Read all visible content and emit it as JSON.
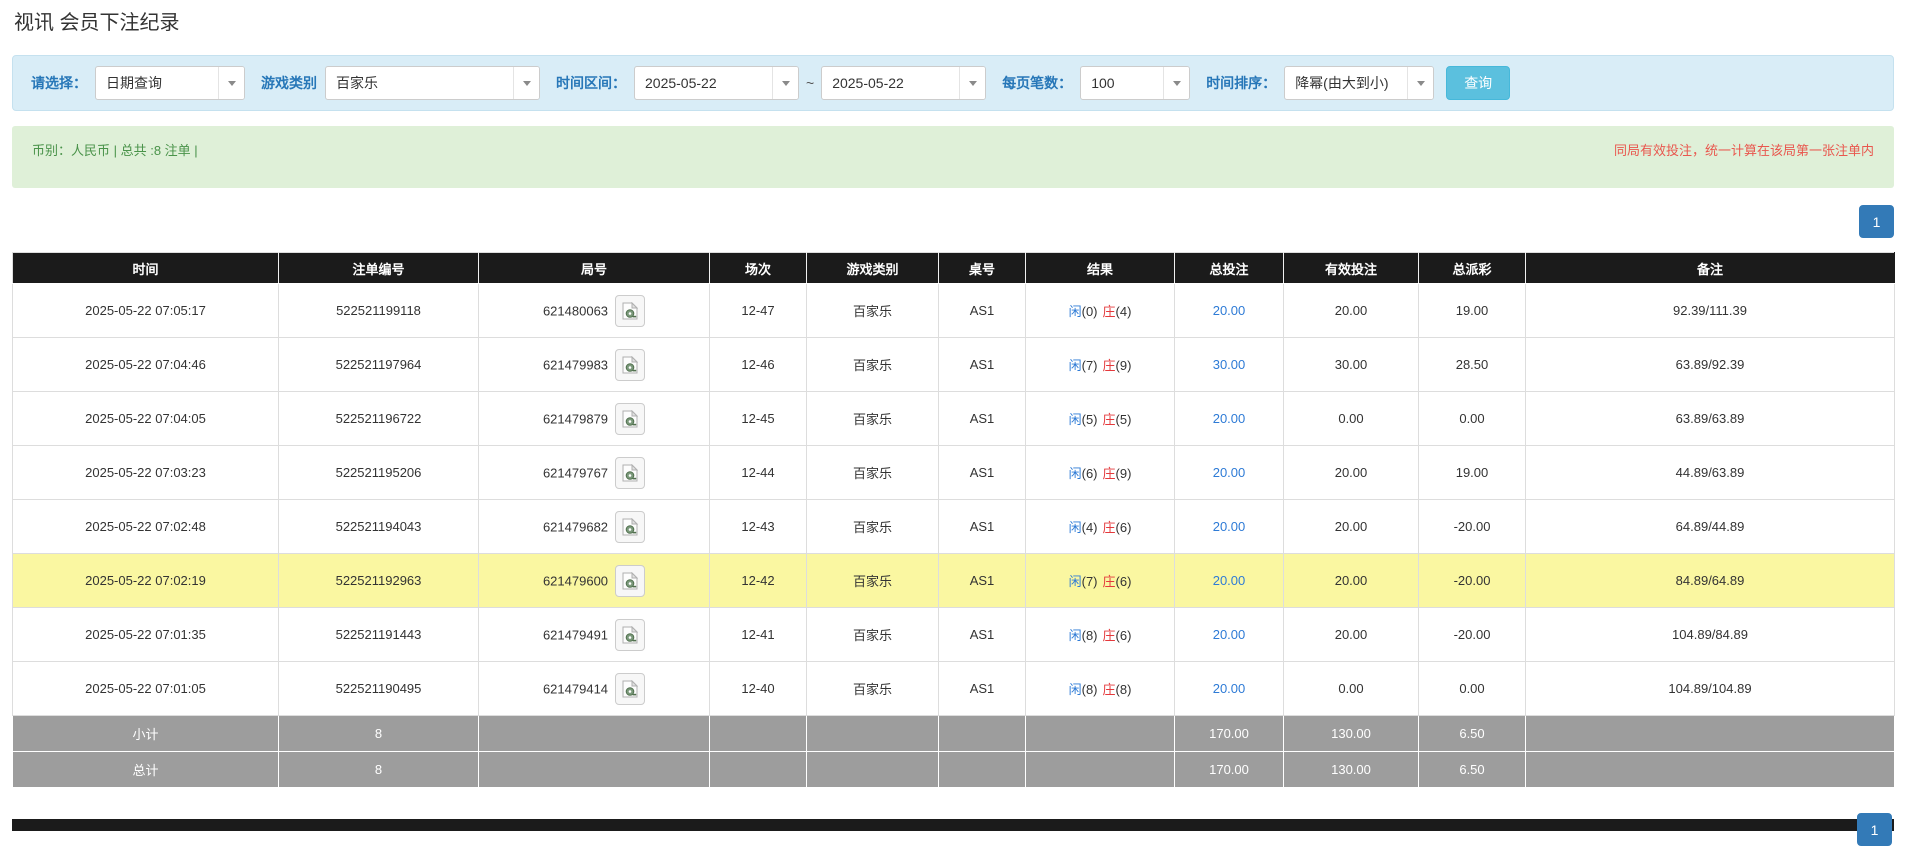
{
  "page_title": "视讯 会员下注纪录",
  "filter_bar": {
    "query_type_label": "请选择：",
    "query_type_value": "日期查询",
    "game_type_label": "游戏类别",
    "game_type_value": "百家乐",
    "time_range_label": "时间区间：",
    "date_from": "2025-05-22",
    "date_separator": "~",
    "date_to": "2025-05-22",
    "page_size_label": "每页笔数：",
    "page_size_value": "100",
    "time_sort_label": "时间排序：",
    "time_sort_value": "降幂(由大到小)",
    "search_button_label": "查询"
  },
  "summary_bar": {
    "currency_summary": "币别：人民币 | 总共 :8 注单 |",
    "note": "同局有效投注，统一计算在该局第一张注单内"
  },
  "pagination": {
    "current_page": "1"
  },
  "table": {
    "headers": [
      "时间",
      "注单编号",
      "局号",
      "场次",
      "游戏类别",
      "桌号",
      "结果",
      "总投注",
      "有效投注",
      "总派彩",
      "备注"
    ],
    "rows": [
      {
        "time": "2025-05-22 07:05:17",
        "bet_no": "522521199118",
        "round_no": "621480063",
        "session": "12-47",
        "game_type": "百家乐",
        "table_no": "AS1",
        "player_label": "闲",
        "player_score": "(0)",
        "banker_label": "庄",
        "banker_score": "(4)",
        "total_bet": "20.00",
        "valid_bet": "20.00",
        "payout": "19.00",
        "remark": "92.39/111.39",
        "highlighted": false
      },
      {
        "time": "2025-05-22 07:04:46",
        "bet_no": "522521197964",
        "round_no": "621479983",
        "session": "12-46",
        "game_type": "百家乐",
        "table_no": "AS1",
        "player_label": "闲",
        "player_score": "(7)",
        "banker_label": "庄",
        "banker_score": "(9)",
        "total_bet": "30.00",
        "valid_bet": "30.00",
        "payout": "28.50",
        "remark": "63.89/92.39",
        "highlighted": false
      },
      {
        "time": "2025-05-22 07:04:05",
        "bet_no": "522521196722",
        "round_no": "621479879",
        "session": "12-45",
        "game_type": "百家乐",
        "table_no": "AS1",
        "player_label": "闲",
        "player_score": "(5)",
        "banker_label": "庄",
        "banker_score": "(5)",
        "total_bet": "20.00",
        "valid_bet": "0.00",
        "payout": "0.00",
        "remark": "63.89/63.89",
        "highlighted": false
      },
      {
        "time": "2025-05-22 07:03:23",
        "bet_no": "522521195206",
        "round_no": "621479767",
        "session": "12-44",
        "game_type": "百家乐",
        "table_no": "AS1",
        "player_label": "闲",
        "player_score": "(6)",
        "banker_label": "庄",
        "banker_score": "(9)",
        "total_bet": "20.00",
        "valid_bet": "20.00",
        "payout": "19.00",
        "remark": "44.89/63.89",
        "highlighted": false
      },
      {
        "time": "2025-05-22 07:02:48",
        "bet_no": "522521194043",
        "round_no": "621479682",
        "session": "12-43",
        "game_type": "百家乐",
        "table_no": "AS1",
        "player_label": "闲",
        "player_score": "(4)",
        "banker_label": "庄",
        "banker_score": "(6)",
        "total_bet": "20.00",
        "valid_bet": "20.00",
        "payout": "-20.00",
        "remark": "64.89/44.89",
        "highlighted": false
      },
      {
        "time": "2025-05-22 07:02:19",
        "bet_no": "522521192963",
        "round_no": "621479600",
        "session": "12-42",
        "game_type": "百家乐",
        "table_no": "AS1",
        "player_label": "闲",
        "player_score": "(7)",
        "banker_label": "庄",
        "banker_score": "(6)",
        "total_bet": "20.00",
        "valid_bet": "20.00",
        "payout": "-20.00",
        "remark": "84.89/64.89",
        "highlighted": true
      },
      {
        "time": "2025-05-22 07:01:35",
        "bet_no": "522521191443",
        "round_no": "621479491",
        "session": "12-41",
        "game_type": "百家乐",
        "table_no": "AS1",
        "player_label": "闲",
        "player_score": "(8)",
        "banker_label": "庄",
        "banker_score": "(6)",
        "total_bet": "20.00",
        "valid_bet": "20.00",
        "payout": "-20.00",
        "remark": "104.89/84.89",
        "highlighted": false
      },
      {
        "time": "2025-05-22 07:01:05",
        "bet_no": "522521190495",
        "round_no": "621479414",
        "session": "12-40",
        "game_type": "百家乐",
        "table_no": "AS1",
        "player_label": "闲",
        "player_score": "(8)",
        "banker_label": "庄",
        "banker_score": "(8)",
        "total_bet": "20.00",
        "valid_bet": "0.00",
        "payout": "0.00",
        "remark": "104.89/104.89",
        "highlighted": false
      }
    ],
    "subtotal_row": {
      "label": "小计",
      "bet_count": "8",
      "total_bet": "170.00",
      "valid_bet": "130.00",
      "payout": "6.50"
    },
    "total_row": {
      "label": "总计",
      "bet_count": "8",
      "total_bet": "170.00",
      "valid_bet": "130.00",
      "payout": "6.50"
    }
  },
  "colors": {
    "filter_bar_bg": "#d9edf7",
    "filter_label_blue": "#2777b8",
    "search_button_bg": "#5bc0de",
    "summary_bg": "#dff0d8",
    "summary_text_green": "#4a934a",
    "note_red": "#e9574e",
    "table_header_bg": "#1b1b1b",
    "link_blue": "#2e7bd6",
    "banker_red": "#e4393c",
    "negative_red": "#e4393c",
    "highlight_yellow": "#faf7a1",
    "summary_row_bg": "#9d9d9d",
    "pagination_blue": "#337ab7"
  }
}
